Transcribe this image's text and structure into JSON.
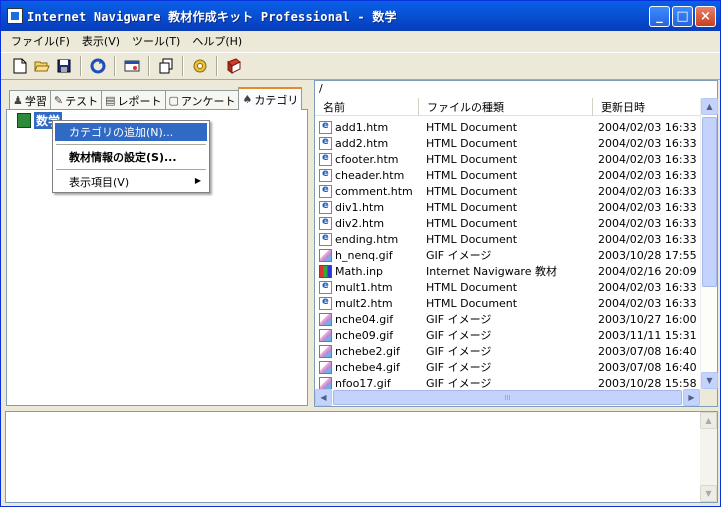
{
  "window": {
    "title": "Internet Navigware 教材作成キット Professional - 数学",
    "buttons": {
      "minimize": "_",
      "maximize": "□",
      "close": "×"
    }
  },
  "menubar": {
    "items": [
      "ファイル(F)",
      "表示(V)",
      "ツール(T)",
      "ヘルプ(H)"
    ]
  },
  "toolbar": {
    "icons": [
      "new-icon",
      "open-icon",
      "save-icon",
      "refresh-icon",
      "properties-icon",
      "copy-icon",
      "settings-icon",
      "book-icon"
    ]
  },
  "left_pane": {
    "tabs": [
      {
        "label": "学習",
        "icon": "study-icon",
        "active": false
      },
      {
        "label": "テスト",
        "icon": "test-icon",
        "active": false
      },
      {
        "label": "レポート",
        "icon": "report-icon",
        "active": false
      },
      {
        "label": "アンケート",
        "icon": "survey-icon",
        "active": false
      },
      {
        "label": "カテゴリ",
        "icon": "category-icon",
        "active": true
      }
    ],
    "tree_node": "数学"
  },
  "context_menu": {
    "items": [
      {
        "label": "カテゴリの追加(N)...",
        "highlighted": true
      },
      {
        "label": "教材情報の設定(S)...",
        "bold": true
      },
      {
        "label": "表示項目(V)",
        "submenu": true
      }
    ]
  },
  "file_list": {
    "path": "/",
    "columns": {
      "name": "名前",
      "type": "ファイルの種類",
      "date": "更新日時"
    },
    "rows": [
      {
        "name": "add1.htm",
        "type": "HTML Document",
        "date": "2004/02/03 16:33",
        "icon": "htm"
      },
      {
        "name": "add2.htm",
        "type": "HTML Document",
        "date": "2004/02/03 16:33",
        "icon": "htm"
      },
      {
        "name": "cfooter.htm",
        "type": "HTML Document",
        "date": "2004/02/03 16:33",
        "icon": "htm"
      },
      {
        "name": "cheader.htm",
        "type": "HTML Document",
        "date": "2004/02/03 16:33",
        "icon": "htm"
      },
      {
        "name": "comment.htm",
        "type": "HTML Document",
        "date": "2004/02/03 16:33",
        "icon": "htm"
      },
      {
        "name": "div1.htm",
        "type": "HTML Document",
        "date": "2004/02/03 16:33",
        "icon": "htm"
      },
      {
        "name": "div2.htm",
        "type": "HTML Document",
        "date": "2004/02/03 16:33",
        "icon": "htm"
      },
      {
        "name": "ending.htm",
        "type": "HTML Document",
        "date": "2004/02/03 16:33",
        "icon": "htm"
      },
      {
        "name": "h_nenq.gif",
        "type": "GIF イメージ",
        "date": "2003/10/28 17:55",
        "icon": "gif"
      },
      {
        "name": "Math.inp",
        "type": "Internet Navigware 教材",
        "date": "2004/02/16 20:09",
        "icon": "inp"
      },
      {
        "name": "mult1.htm",
        "type": "HTML Document",
        "date": "2004/02/03 16:33",
        "icon": "htm"
      },
      {
        "name": "mult2.htm",
        "type": "HTML Document",
        "date": "2004/02/03 16:33",
        "icon": "htm"
      },
      {
        "name": "nche04.gif",
        "type": "GIF イメージ",
        "date": "2003/10/27 16:00",
        "icon": "gif"
      },
      {
        "name": "nche09.gif",
        "type": "GIF イメージ",
        "date": "2003/11/11 15:31",
        "icon": "gif"
      },
      {
        "name": "nchebe2.gif",
        "type": "GIF イメージ",
        "date": "2003/07/08 16:40",
        "icon": "gif"
      },
      {
        "name": "nchebe4.gif",
        "type": "GIF イメージ",
        "date": "2003/07/08 16:40",
        "icon": "gif"
      },
      {
        "name": "nfoo17.gif",
        "type": "GIF イメージ",
        "date": "2003/10/28 15:58",
        "icon": "gif"
      }
    ]
  },
  "scrollbar": {
    "grip": "III",
    "up": "▲",
    "down": "▼",
    "left": "◀",
    "right": "▶"
  }
}
